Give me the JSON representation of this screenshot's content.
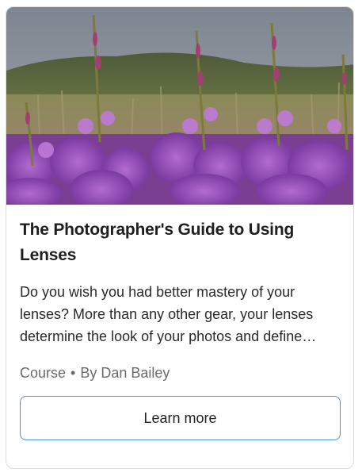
{
  "card": {
    "image_alt": "Field of purple fireweed flowers with green hills behind",
    "title": "The Photographer's Guide to Using Lenses",
    "description": "Do you wish you had better mastery of your lenses? More than any other gear, your lenses determine the look of your photos and define…",
    "meta": {
      "type": "Course",
      "separator": "•",
      "author": "By Dan Bailey"
    },
    "button_label": "Learn more"
  },
  "colors": {
    "button_border": "#4a90d9",
    "meta_text": "#6b6b6b",
    "card_border": "#dcdcdc"
  }
}
